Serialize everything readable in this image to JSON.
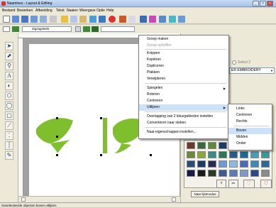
{
  "window": {
    "title": "Naamloos - Layout & Editing",
    "minimize_glyph": "_",
    "maximize_glyph": "□",
    "close_glyph": "×"
  },
  "menubar": [
    "Bestand",
    "Bewerken",
    "Afbeelding",
    "Tekst",
    "Naaien",
    "Weergave",
    "Optie",
    "Help"
  ],
  "toolbar2": {
    "stitch_type": "Zigzagsteek"
  },
  "context_menu": {
    "items": [
      {
        "label": "Groep maken",
        "disabled": false
      },
      {
        "label": "Groep opheffen",
        "disabled": true
      },
      {
        "label": "Knippen",
        "disabled": false
      },
      {
        "label": "Kopiëren",
        "disabled": false
      },
      {
        "label": "Dupliceren",
        "disabled": false
      },
      {
        "label": "Plakken",
        "disabled": false
      },
      {
        "label": "Verwijderen",
        "disabled": false
      },
      {
        "label": "Spiegelen",
        "disabled": false,
        "submenu": true
      },
      {
        "label": "Roteren",
        "disabled": false
      },
      {
        "label": "Centreren",
        "disabled": false
      },
      {
        "label": "Uitlijnen",
        "disabled": false,
        "submenu": true,
        "highlighted": true
      },
      {
        "label": "Overlapping van 2 kleurgebieden instellen",
        "disabled": false
      },
      {
        "label": "Converteren naar steken",
        "disabled": false
      },
      {
        "label": "Naai-eigenschappen instellen...",
        "disabled": false
      }
    ]
  },
  "align_submenu": {
    "items": [
      {
        "label": "Links"
      },
      {
        "label": "Centreren"
      },
      {
        "label": "Rechts"
      },
      {
        "label": "Boven",
        "highlighted": true
      },
      {
        "label": "Midden"
      },
      {
        "label": "Onder"
      }
    ]
  },
  "right_panel": {
    "select2_label": "Select 2",
    "thread_brand": "ER EMBROIDERY",
    "button_label": "Naar lijstmodus"
  },
  "statusbar": {
    "text": "Geselecteerde objecten boven uitlijnen"
  },
  "colors": {
    "leaf_green": "#7fbf2e",
    "highlight": "#cde2f9"
  }
}
